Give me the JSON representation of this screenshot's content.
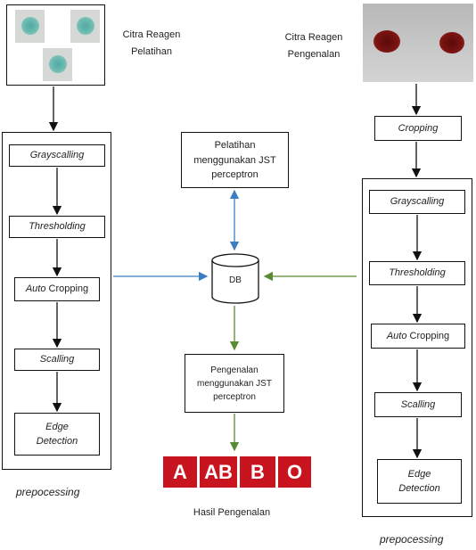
{
  "training_image": {
    "label_line1": "Citra Reagen",
    "label_line2": "Pelatihan"
  },
  "recognition_image": {
    "label_line1": "Citra Reagen",
    "label_line2": "Pengenalan"
  },
  "left_preprocessing": {
    "steps": [
      {
        "italic": "Grayscalling",
        "normal": ""
      },
      {
        "italic": "Thresholding",
        "normal": ""
      },
      {
        "italic": "Auto",
        "normal": " Cropping"
      },
      {
        "italic": "Scalling",
        "normal": ""
      },
      {
        "italic": "Edge Detection",
        "normal": ""
      }
    ],
    "caption": "prepocessing"
  },
  "right_preprocessing": {
    "cropping": "Cropping",
    "steps": [
      {
        "italic": "Grayscalling",
        "normal": ""
      },
      {
        "italic": "Thresholding",
        "normal": ""
      },
      {
        "italic": "Auto",
        "normal": " Cropping"
      },
      {
        "italic": "Scalling",
        "normal": ""
      },
      {
        "italic": "Edge Detection",
        "normal": ""
      }
    ],
    "caption": "prepocessing"
  },
  "training": "Pelatihan menggunakan JST perceptron",
  "database": "DB",
  "recognition": "Pengenalan menggunakan JST perceptron",
  "results": {
    "labels": [
      "A",
      "AB",
      "B",
      "O"
    ],
    "caption": "Hasil Pengenalan",
    "color": "#c8141e"
  },
  "colors": {
    "training_arrows": "#3b7dc4",
    "recognition_arrows": "#5a8a32"
  }
}
